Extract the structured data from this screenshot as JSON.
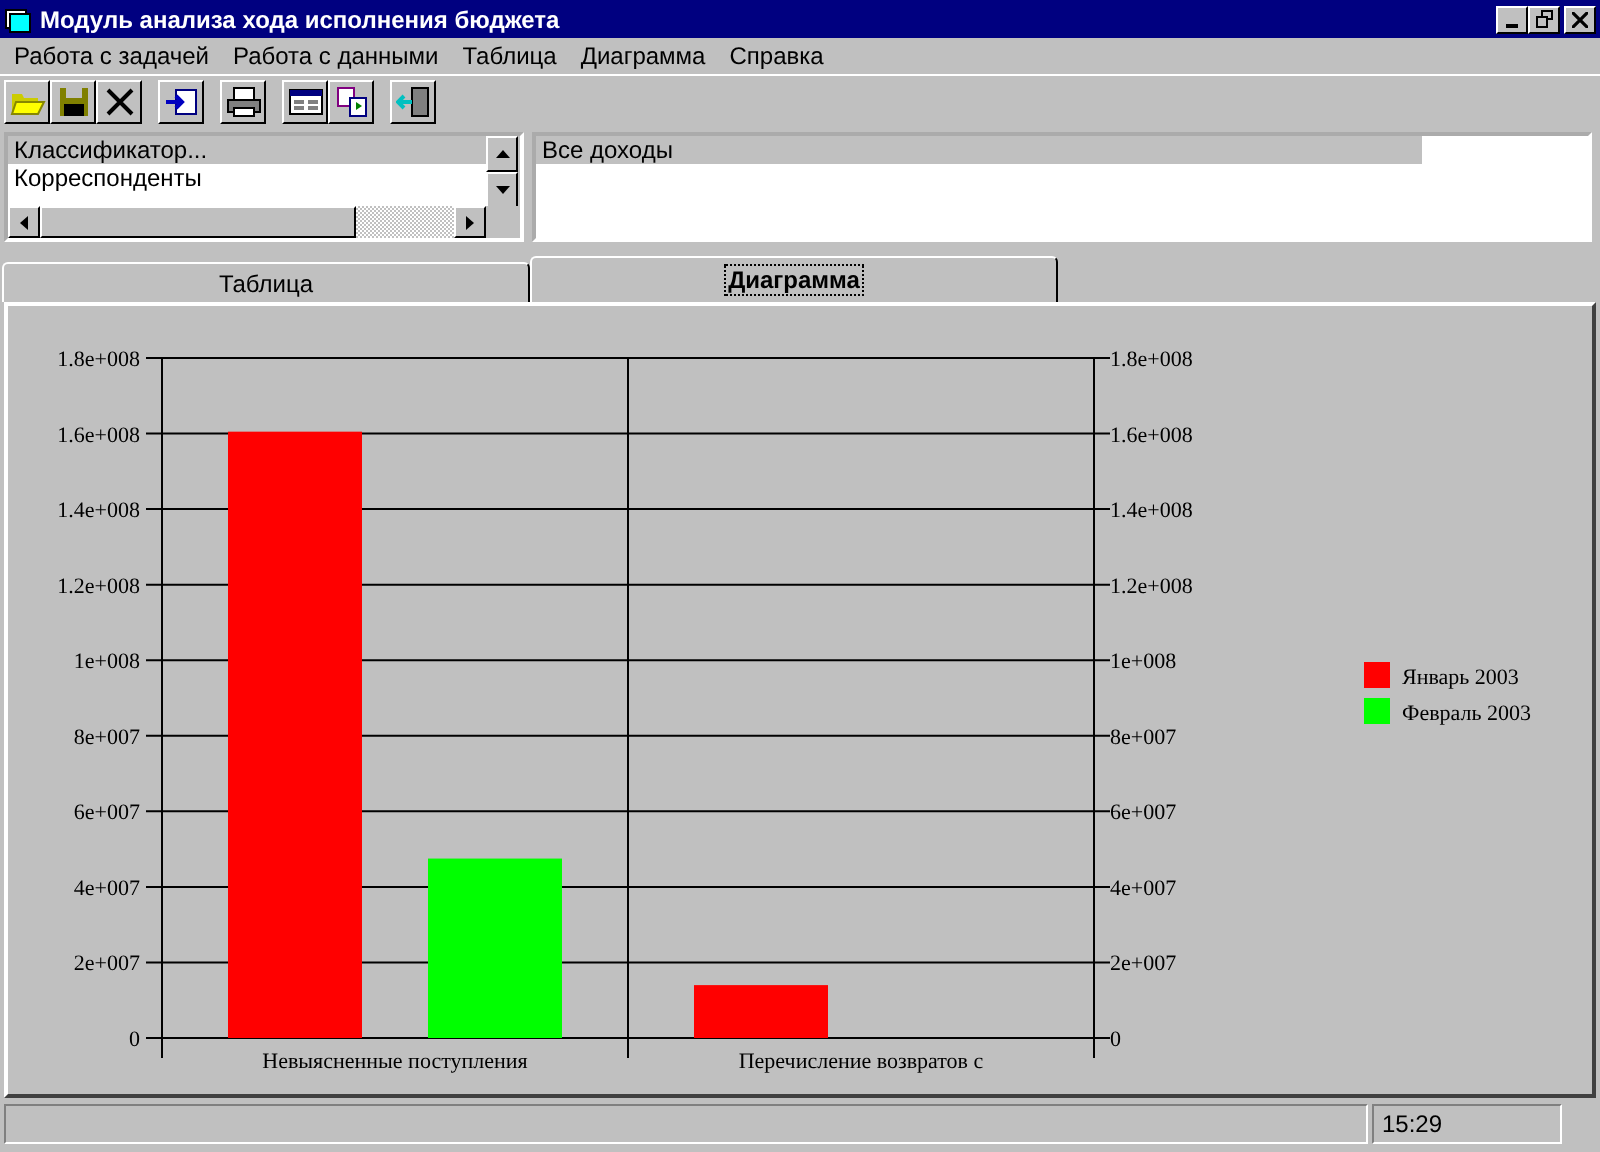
{
  "window": {
    "title": "Модуль анализа хода исполнения бюджета"
  },
  "menu": [
    "Работа с задачей",
    "Работа с данными",
    "Таблица",
    "Диаграмма",
    "Справка"
  ],
  "left_list": {
    "items": [
      {
        "label": "Классификатор...",
        "selected": true
      },
      {
        "label": "Корреспонденты",
        "selected": false
      }
    ]
  },
  "right_list": {
    "items": [
      {
        "label": "Все доходы",
        "selected": true
      }
    ]
  },
  "tabs": [
    {
      "label": "Таблица",
      "selected": false
    },
    {
      "label": "Диаграмма",
      "selected": true
    }
  ],
  "chart": {
    "chart_data": {
      "type": "bar",
      "categories": [
        "Невыясненные поступления",
        "Перечисление возвратов с"
      ],
      "series": [
        {
          "name": "Январь 2003",
          "color": "#ff0000",
          "values": [
            160500000,
            14000000
          ]
        },
        {
          "name": "Февраль 2003",
          "color": "#00ff00",
          "values": [
            47500000,
            null
          ]
        }
      ],
      "ylim": [
        0,
        180000000
      ],
      "grid": true,
      "legend": true,
      "yticks": [
        {
          "value": 0,
          "label": "0"
        },
        {
          "value": 20000000,
          "label": "2e+007"
        },
        {
          "value": 40000000,
          "label": "4e+007"
        },
        {
          "value": 60000000,
          "label": "6e+007"
        },
        {
          "value": 80000000,
          "label": "8e+007"
        },
        {
          "value": 100000000,
          "label": "1e+008"
        },
        {
          "value": 120000000,
          "label": "1.2e+008"
        },
        {
          "value": 140000000,
          "label": "1.4e+008"
        },
        {
          "value": 160000000,
          "label": "1.6e+008"
        },
        {
          "value": 180000000,
          "label": "1.8e+008"
        }
      ]
    }
  },
  "status_bar": {
    "time": "15:29"
  }
}
